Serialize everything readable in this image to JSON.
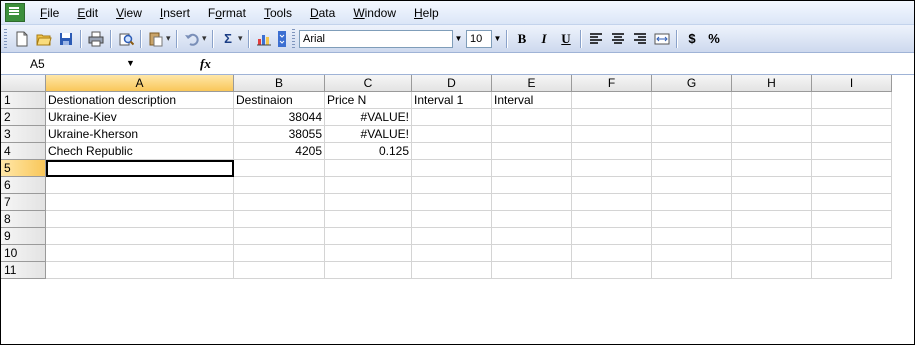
{
  "menu": {
    "items": [
      {
        "key": "F",
        "rest": "ile"
      },
      {
        "key": "E",
        "rest": "dit"
      },
      {
        "key": "V",
        "rest": "iew"
      },
      {
        "key": "I",
        "rest": "nsert"
      },
      {
        "pre": "F",
        "key": "o",
        "rest": "rmat"
      },
      {
        "key": "T",
        "rest": "ools"
      },
      {
        "key": "D",
        "rest": "ata"
      },
      {
        "key": "W",
        "rest": "indow"
      },
      {
        "key": "H",
        "rest": "elp"
      }
    ]
  },
  "toolbar": {
    "font_name": "Arial",
    "font_size": "10",
    "bold_label": "B",
    "italic_label": "I",
    "underline_label": "U",
    "sum_label": "Σ",
    "currency_label": "$",
    "percent_label": "%"
  },
  "formula_bar": {
    "name_box": "A5",
    "fx_label": "fx",
    "formula": ""
  },
  "grid": {
    "columns": [
      "A",
      "B",
      "C",
      "D",
      "E",
      "F",
      "G",
      "H",
      "I"
    ],
    "row_numbers": [
      "1",
      "2",
      "3",
      "4",
      "5",
      "6",
      "7",
      "8",
      "9",
      "10",
      "11"
    ],
    "cells": [
      [
        "Destionation description",
        "Destinaion",
        "Price N",
        "Interval 1",
        "Interval",
        "",
        "",
        "",
        ""
      ],
      [
        "Ukraine-Kiev",
        "38044",
        "#VALUE!",
        "",
        "",
        "",
        "",
        "",
        ""
      ],
      [
        "Ukraine-Kherson",
        "38055",
        "#VALUE!",
        "",
        "",
        "",
        "",
        "",
        ""
      ],
      [
        "Chech Republic",
        "4205",
        "0.125",
        "",
        "",
        "",
        "",
        "",
        ""
      ],
      [
        "",
        "",
        "",
        "",
        "",
        "",
        "",
        "",
        ""
      ],
      [
        "",
        "",
        "",
        "",
        "",
        "",
        "",
        "",
        ""
      ],
      [
        "",
        "",
        "",
        "",
        "",
        "",
        "",
        "",
        ""
      ],
      [
        "",
        "",
        "",
        "",
        "",
        "",
        "",
        "",
        ""
      ],
      [
        "",
        "",
        "",
        "",
        "",
        "",
        "",
        "",
        ""
      ],
      [
        "",
        "",
        "",
        "",
        "",
        "",
        "",
        "",
        ""
      ],
      [
        "",
        "",
        "",
        "",
        "",
        "",
        "",
        "",
        ""
      ]
    ],
    "selected_cell": "A5"
  }
}
